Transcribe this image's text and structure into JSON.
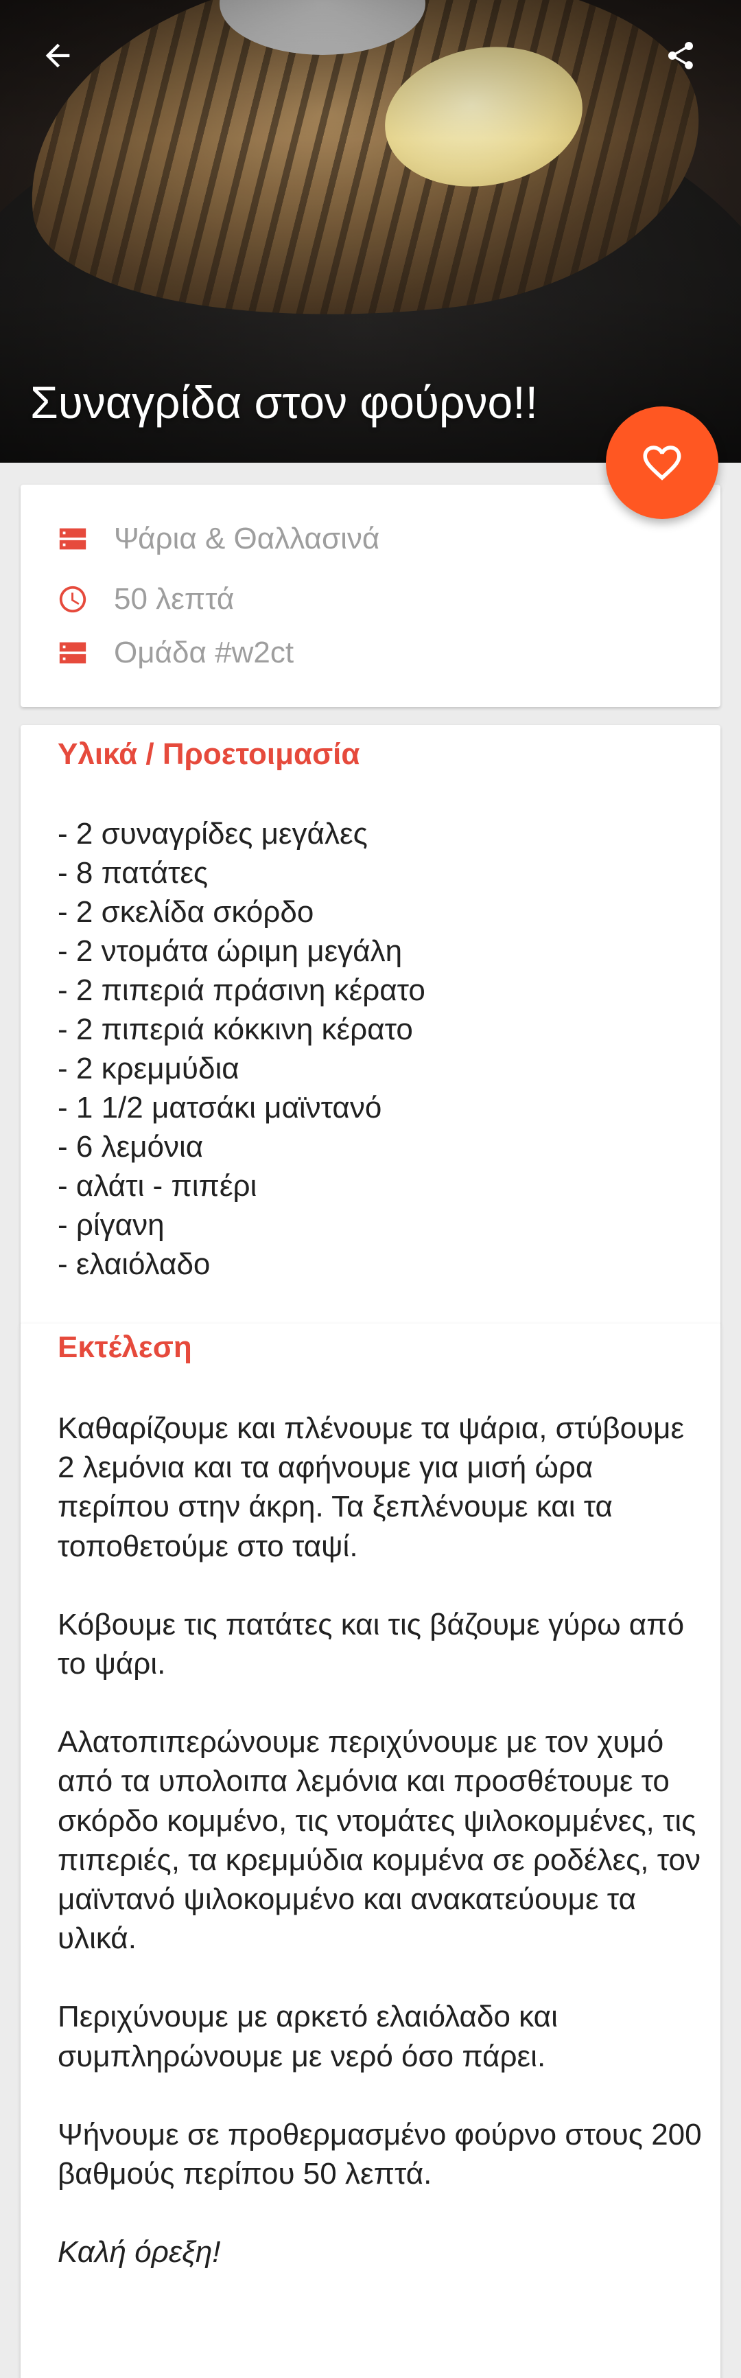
{
  "hero": {
    "title": "Συναγρίδα στον φούρνο!!",
    "back_icon": "arrow-left-icon",
    "share_icon": "share-icon"
  },
  "fab": {
    "icon": "heart-outline-icon",
    "color": "#ff5722"
  },
  "info": {
    "category": "Ψάρια & Θαλλασινά",
    "time": "50 λεπτά",
    "group": "Ομάδα #w2ct",
    "icon_color": "#e64a3c"
  },
  "ingredients": {
    "title": "Υλικά / Προετοιμασία",
    "items": [
      "- 2 συναγρίδες μεγάλες",
      "- 8 πατάτες",
      "- 2 σκελίδα σκόρδο",
      "- 2 ντομάτα ώριμη μεγάλη",
      "- 2 πιπεριά πράσινη κέρατο",
      "- 2 πιπεριά κόκκινη κέρατο",
      "- 2 κρεμμύδια",
      "- 1 1/2 ματσάκι μαϊντανό",
      "- 6 λεμόνια",
      "- αλάτι - πιπέρι",
      "- ρίγανη",
      "- ελαιόλαδο"
    ]
  },
  "steps": {
    "title": "Εκτέλεση",
    "paragraphs": [
      "Καθαρίζουμε και πλένουμε τα ψάρια, στύβουμε 2 λεμόνια και τα αφήνουμε για μισή ώρα περίπου στην άκρη. Τα ξεπλένουμε και τα τοποθετούμε στο ταψί.",
      "Κόβουμε τις πατάτες και τις βάζουμε γύρω από το ψάρι.",
      "Αλατοπιπερώνουμε περιχύνουμε με τον χυμό από τα υπολοιπα λεμόνια και προσθέτουμε το σκόρδο κομμένο, τις ντομάτες ψιλοκομμένες, τις πιπεριές, τα κρεμμύδια κομμένα σε ροδέλες, τον μαϊντανό ψιλοκομμένο και ανακατεύουμε τα υλικά.",
      "Περιχύνουμε με αρκετό ελαιόλαδο και συμπληρώνουμε με νερό όσο πάρει.",
      "Ψήνουμε σε προθερμασμένο φούρνο στους 200 βαθμούς περίπου 50 λεπτά."
    ],
    "closing": "Καλή όρεξη!"
  }
}
